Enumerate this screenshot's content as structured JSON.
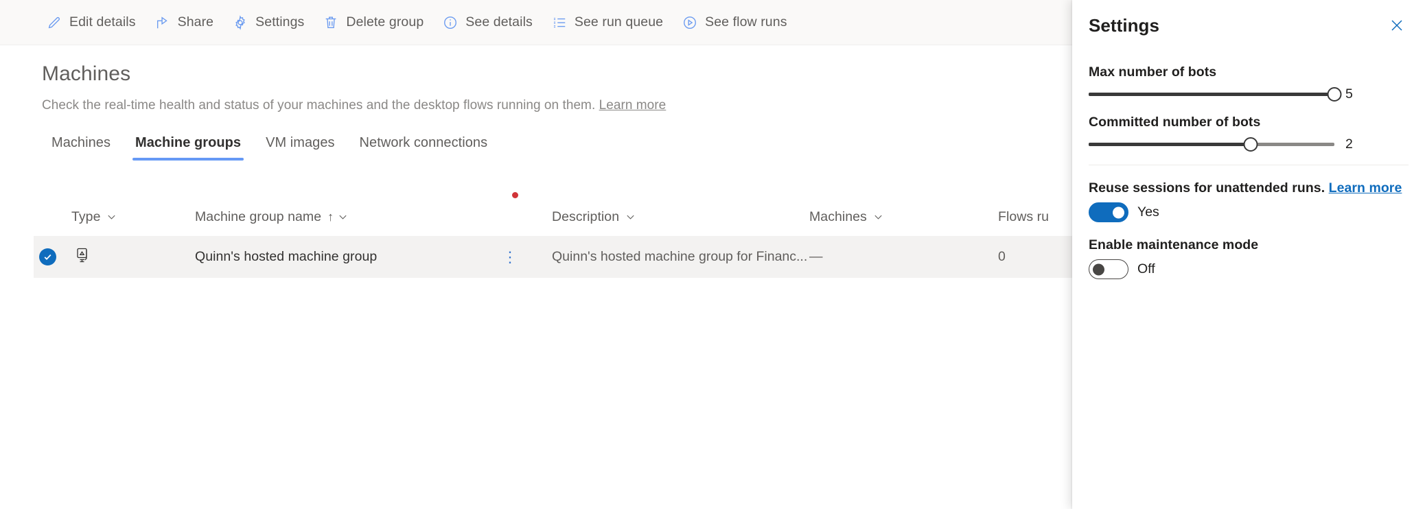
{
  "commandbar": {
    "items": [
      {
        "label": "Edit details",
        "icon": "pencil-icon"
      },
      {
        "label": "Share",
        "icon": "share-icon"
      },
      {
        "label": "Settings",
        "icon": "gear-icon"
      },
      {
        "label": "Delete group",
        "icon": "trash-icon"
      },
      {
        "label": "See details",
        "icon": "info-icon"
      },
      {
        "label": "See run queue",
        "icon": "list-icon"
      },
      {
        "label": "See flow runs",
        "icon": "play-circle-icon"
      }
    ]
  },
  "page": {
    "title": "Machines",
    "subtitle": "Check the real-time health and status of your machines and the desktop flows running on them.",
    "subtitle_link": "Learn more"
  },
  "tabs": [
    {
      "label": "Machines",
      "active": false
    },
    {
      "label": "Machine groups",
      "active": true
    },
    {
      "label": "VM images",
      "active": false
    },
    {
      "label": "Network connections",
      "active": false
    }
  ],
  "table": {
    "headers": {
      "type": "Type",
      "name": "Machine group name",
      "sort_indicator": "↑",
      "description": "Description",
      "machines": "Machines",
      "flows": "Flows ru"
    },
    "rows": [
      {
        "selected": true,
        "type_icon": "machine-group-icon",
        "name": "Quinn's hosted machine group",
        "kebab": "⋮",
        "description": "Quinn's hosted machine group for Financ...",
        "machines": "—",
        "flows_running": "0"
      }
    ]
  },
  "panel": {
    "title": "Settings",
    "close_icon": "close-icon",
    "max_bots": {
      "label": "Max number of bots",
      "value": "5",
      "percent": 100
    },
    "committed_bots": {
      "label": "Committed number of bots",
      "value": "2",
      "percent": 66
    },
    "reuse_sessions": {
      "label": "Reuse sessions for unattended runs.",
      "link": "Learn more",
      "state": "Yes",
      "on": true
    },
    "maintenance_mode": {
      "label": "Enable maintenance mode",
      "state": "Off",
      "on": false
    }
  },
  "colors": {
    "accent_blue": "#0f6cbd",
    "tab_underline": "#6699f5",
    "icon_blue": "#6b9bf0",
    "red_dot": "#d13438"
  }
}
